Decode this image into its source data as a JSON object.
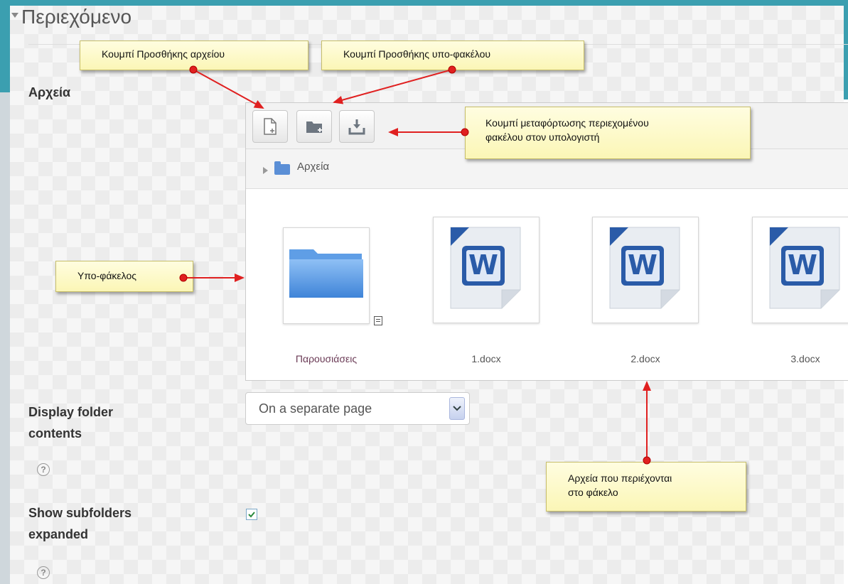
{
  "section": {
    "title": "Περιεχόμενο"
  },
  "fields": {
    "files_label": "Αρχεία",
    "display_label_line1": "Display folder",
    "display_label_line2": "contents",
    "show_label_line1": "Show subfolders",
    "show_label_line2": "expanded",
    "help_glyph": "?"
  },
  "filemanager": {
    "path_label": "Αρχεία",
    "items": [
      {
        "name": "Παρουσιάσεις",
        "type": "folder"
      },
      {
        "name": "1.docx",
        "type": "word-document"
      },
      {
        "name": "2.docx",
        "type": "word-document"
      },
      {
        "name": "3.docx",
        "type": "word-document"
      }
    ]
  },
  "display_select": {
    "selected": "On a separate page"
  },
  "show_subfolders": {
    "checked": true
  },
  "callouts": {
    "add_file": "Κουμπί Προσθήκης αρχείου",
    "add_folder": "Κουμπί Προσθήκης υπο-φακέλου",
    "download_line1": "Κουμπί μεταφόρτωσης περιεχομένου",
    "download_line2": "φακέλου στον υπολογιστή",
    "subfolder": "Υπο-φάκελος",
    "files_in_folder_line1": "Αρχεία που περιέχονται",
    "files_in_folder_line2": "στο φάκελο"
  },
  "colors": {
    "frame": "#3b9fb0",
    "callout_bg": "#fbf6b6",
    "annotation_arrow": "#e02020",
    "folder_blue": "#5b8fd6",
    "word_blue": "#2a5ba8"
  }
}
